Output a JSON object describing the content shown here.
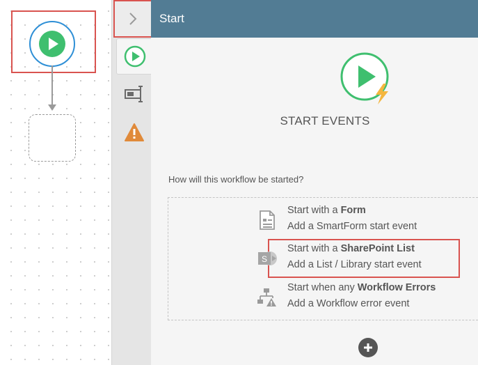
{
  "panel": {
    "title": "Start",
    "hero_title": "START EVENTS",
    "question": "How will this workflow be started?"
  },
  "options": [
    {
      "prefix": "Start with a ",
      "bold": "Form",
      "description": "Add a SmartForm start event",
      "icon": "form-document-icon"
    },
    {
      "prefix": "Start with a ",
      "bold": "SharePoint List",
      "description": "Add a List / Library start event",
      "icon": "sharepoint-icon"
    },
    {
      "prefix": "Start when any ",
      "bold": "Workflow Errors",
      "description": "Add a Workflow error event",
      "icon": "workflow-error-icon"
    }
  ],
  "tabs": [
    {
      "icon": "start-play-icon",
      "active": true
    },
    {
      "icon": "input-field-icon",
      "active": false
    },
    {
      "icon": "warning-icon",
      "active": false
    }
  ],
  "colors": {
    "header_bg": "#527c94",
    "accent_green": "#3fbf6f",
    "node_border_blue": "#2e8fd6",
    "highlight_red": "#d9534f",
    "warning_orange": "#e08a3a"
  }
}
